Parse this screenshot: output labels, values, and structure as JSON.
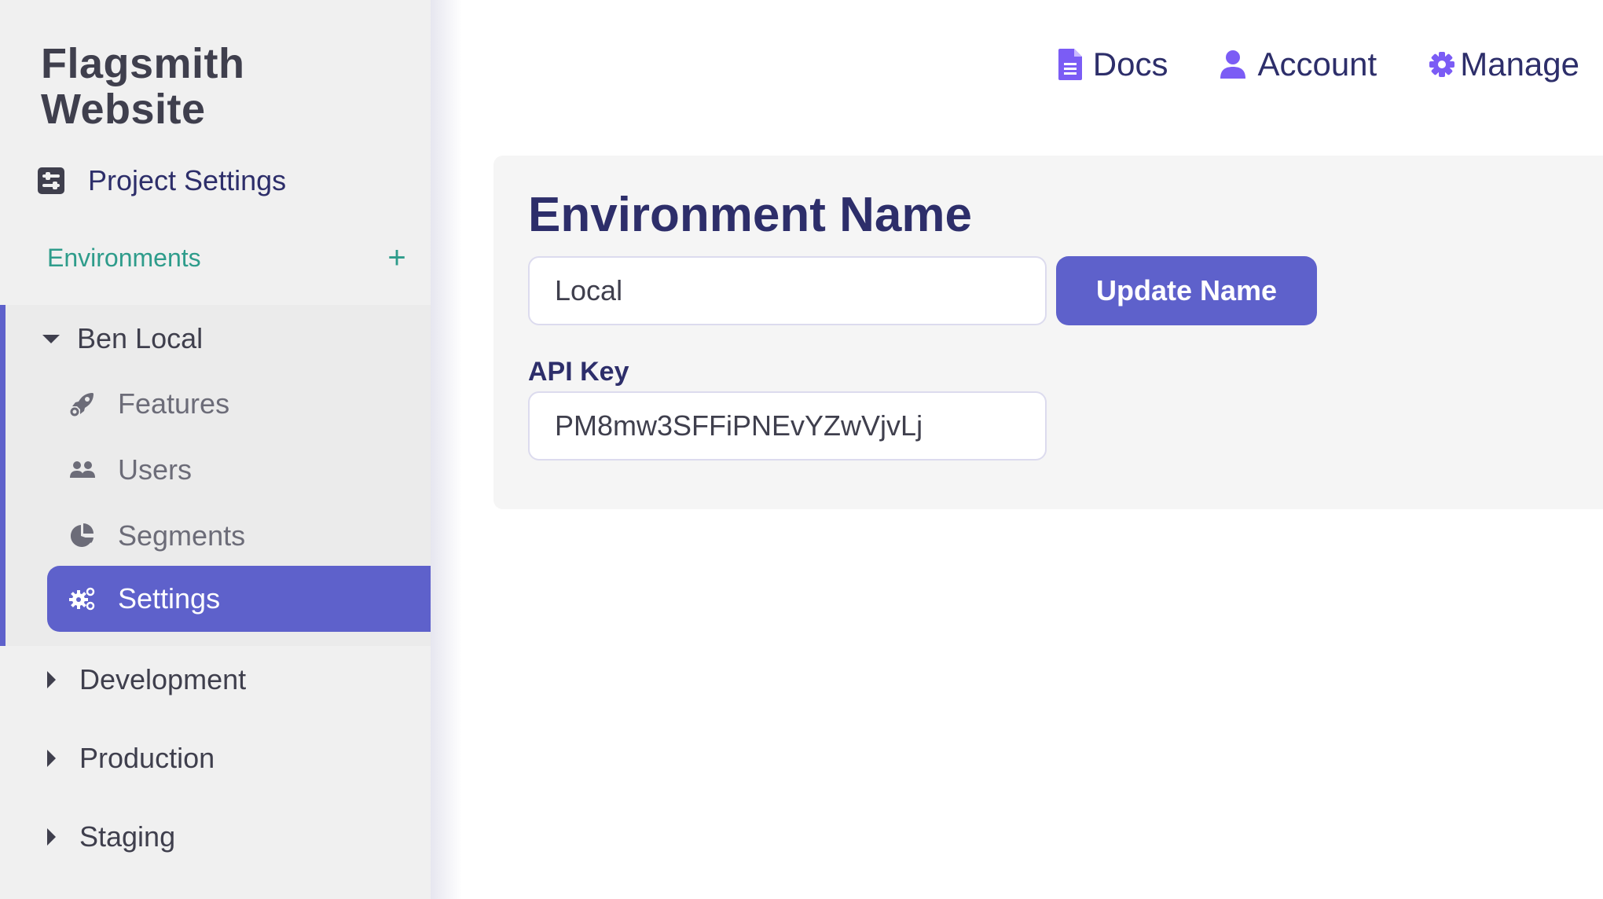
{
  "sidebar": {
    "project_title": "Flagsmith Website",
    "project_settings_label": "Project Settings",
    "environments_label": "Environments",
    "add_environment_symbol": "+",
    "environments": [
      {
        "name": "Ben Local",
        "expanded": true,
        "items": [
          {
            "label": "Features",
            "icon": "rocket-icon",
            "active": false
          },
          {
            "label": "Users",
            "icon": "users-icon",
            "active": false
          },
          {
            "label": "Segments",
            "icon": "pie-chart-icon",
            "active": false
          },
          {
            "label": "Settings",
            "icon": "cogs-icon",
            "active": true
          }
        ]
      },
      {
        "name": "Development",
        "expanded": false
      },
      {
        "name": "Production",
        "expanded": false
      },
      {
        "name": "Staging",
        "expanded": false
      }
    ]
  },
  "top_nav": {
    "links": [
      {
        "label": "Docs",
        "icon": "document-icon"
      },
      {
        "label": "Account",
        "icon": "user-icon"
      },
      {
        "label": "Manage",
        "icon": "gear-icon"
      }
    ]
  },
  "main": {
    "section_title": "Environment Name",
    "name_input_value": "Local",
    "update_button_label": "Update Name",
    "api_key_label": "API Key",
    "api_key_value": "PM8mw3SFFiPNEvYZwVjvLj"
  },
  "colors": {
    "accent": "#5e61cb",
    "nav_icon": "#7b5cf5",
    "heading": "#2d2e6a",
    "environments_label": "#2e9c8b",
    "sidebar_bg": "#f0f0f0",
    "panel_bg": "#f5f5f5"
  }
}
